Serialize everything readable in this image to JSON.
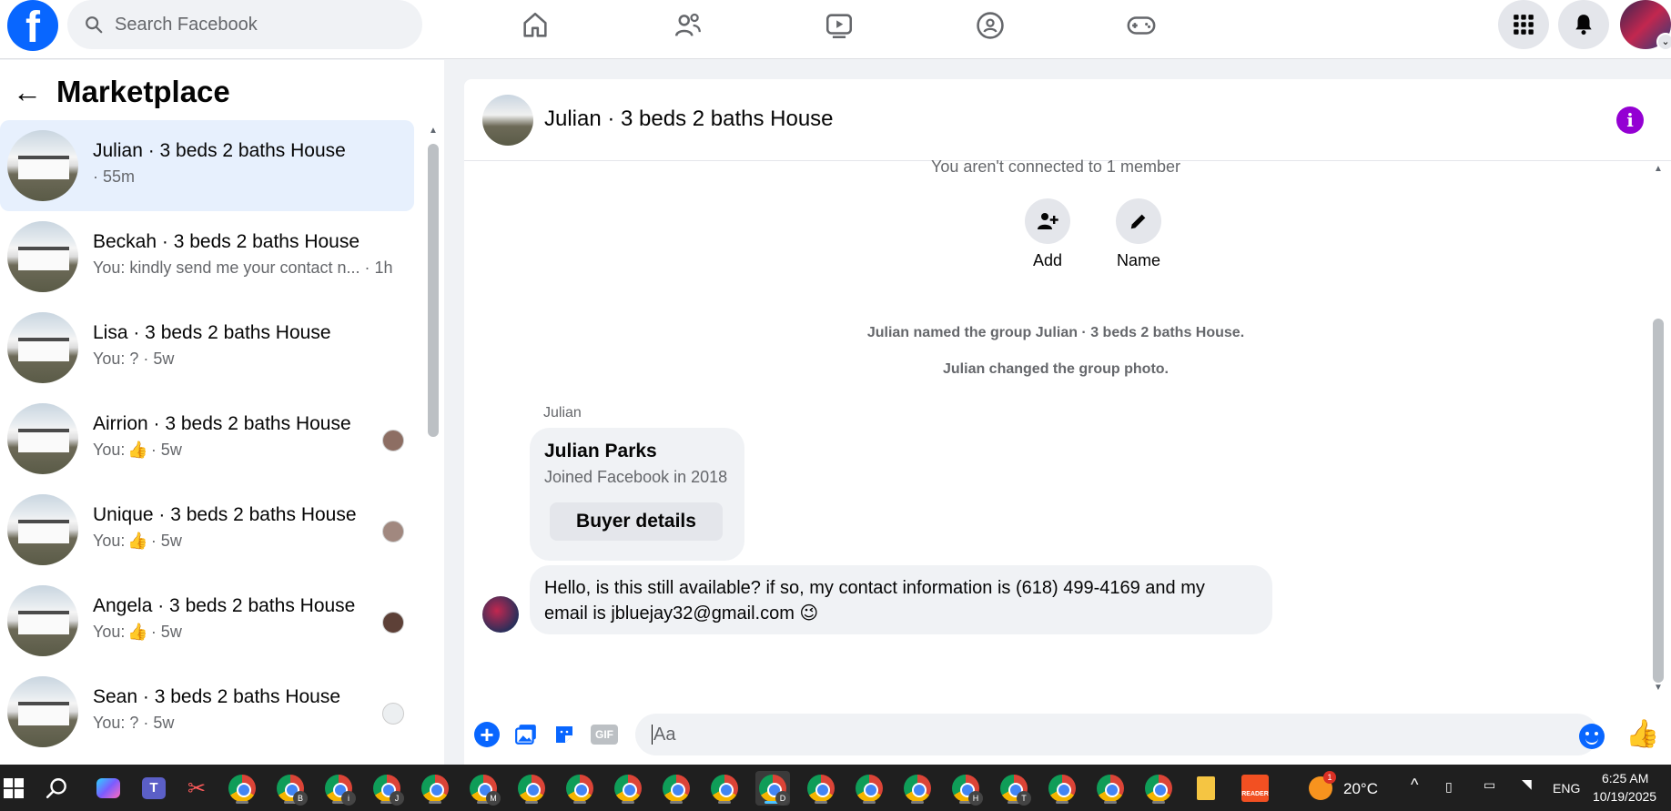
{
  "topbar": {
    "search_placeholder": "Search Facebook",
    "nav": [
      "home-icon",
      "friends-icon",
      "video-icon",
      "groups-icon",
      "gaming-icon"
    ],
    "accent": "#0866ff"
  },
  "sidebar": {
    "title": "Marketplace",
    "conversations": [
      {
        "title": "Julian · 3 beds 2 baths House",
        "sub": "· 55m"
      },
      {
        "title": "Beckah · 3 beds 2 baths House",
        "sub": "You: kindly send me your contact n... · 1h"
      },
      {
        "title": "Lisa · 3 beds 2 baths House",
        "sub": "You: ? · 5w"
      },
      {
        "title": "Airrion · 3 beds 2 baths House",
        "sub_prefix": "You:",
        "sub_suffix": "· 5w"
      },
      {
        "title": "Unique · 3 beds 2 baths House",
        "sub_prefix": "You:",
        "sub_suffix": "· 5w"
      },
      {
        "title": "Angela · 3 beds 2 baths House",
        "sub_prefix": "You:",
        "sub_suffix": "· 5w"
      },
      {
        "title": "Sean · 3 beds 2 baths House",
        "sub": "You: ? · 5w"
      }
    ]
  },
  "chat": {
    "title": "Julian · 3 beds 2 baths House",
    "not_connected": "You aren't connected to 1 member",
    "actions": {
      "add": "Add",
      "name": "Name"
    },
    "events": [
      "Julian named the group Julian · 3 beds 2 baths House.",
      "Julian changed the group photo."
    ],
    "sender": "Julian",
    "card": {
      "name": "Julian Parks",
      "joined": "Joined Facebook in 2018",
      "button": "Buyer details"
    },
    "message_line1": "Hello, is this still available? if so, my contact information is (618) 499-4169 and my",
    "message_line2": "email is jbluejay32@gmail.com 😉",
    "composer_placeholder": "Aa",
    "gif_label": "GIF"
  },
  "taskbar": {
    "temperature": "20°C",
    "language": "ENG",
    "time": "6:25 AM",
    "date": "10/19/2025",
    "chrome_badges": [
      "",
      "B",
      "i",
      "J",
      "",
      "M",
      "",
      "",
      "",
      "",
      "",
      "D",
      "",
      "",
      "",
      "H",
      "T",
      "",
      "",
      ""
    ],
    "weather_badge": "1"
  }
}
